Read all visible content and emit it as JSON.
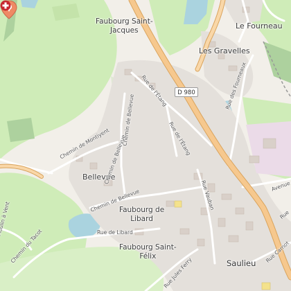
{
  "map": {
    "places": {
      "faubourg_saint_jacques_1": "Faubourg Saint-",
      "faubourg_saint_jacques_2": "Jacques",
      "le_fourneau": "Le Fourneau",
      "les_gravelles": "Les Gravelles",
      "bellevue": "Bellevue",
      "faubourg_de_libard_1": "Faubourg de",
      "faubourg_de_libard_2": "Libard",
      "faubourg_saint_felix_1": "Faubourg Saint-",
      "faubourg_saint_felix_2": "Félix",
      "saulieu": "Saulieu"
    },
    "road_shield": "D 980",
    "streets": {
      "rue_de_l_etang_upper": "Rue de l'Étang",
      "chemin_de_bellevue_top": "Chemin de Bellevue",
      "rue_de_l_etang_lower": "Rue de l'Étang",
      "chemin_de_montiyent": "Chemin de Montiyent",
      "rue_des_fourneaux": "Rue des Fourneaux",
      "chemin_de_bellevue_mid": "Chemin de Bellevue",
      "chemin_de_bellevue_low": "Chemin de Bellevue",
      "rue_vauban": "Rue Vauban",
      "avenue": "Avenue",
      "rue_de_libard": "Rue de Libard",
      "chemin_du_tacot": "Chemin du Tacot",
      "moulin_a_vent": "Moulin à Vent",
      "rue_jules_ferry": "Rue Jules Ferry",
      "rue_carnot": "Rue Carnot",
      "rue_edge": "Rue"
    },
    "icons": {
      "pin": "location-pin-icon",
      "pharmacy": "red-cross-icon"
    },
    "colors": {
      "background": "#f2efe9",
      "meadow": "#cfecb8",
      "forest": "#add19e",
      "water": "#aad3df",
      "main_road": "#f6c88e",
      "pin": "#ef8a65",
      "cross": "#c6282e"
    }
  }
}
